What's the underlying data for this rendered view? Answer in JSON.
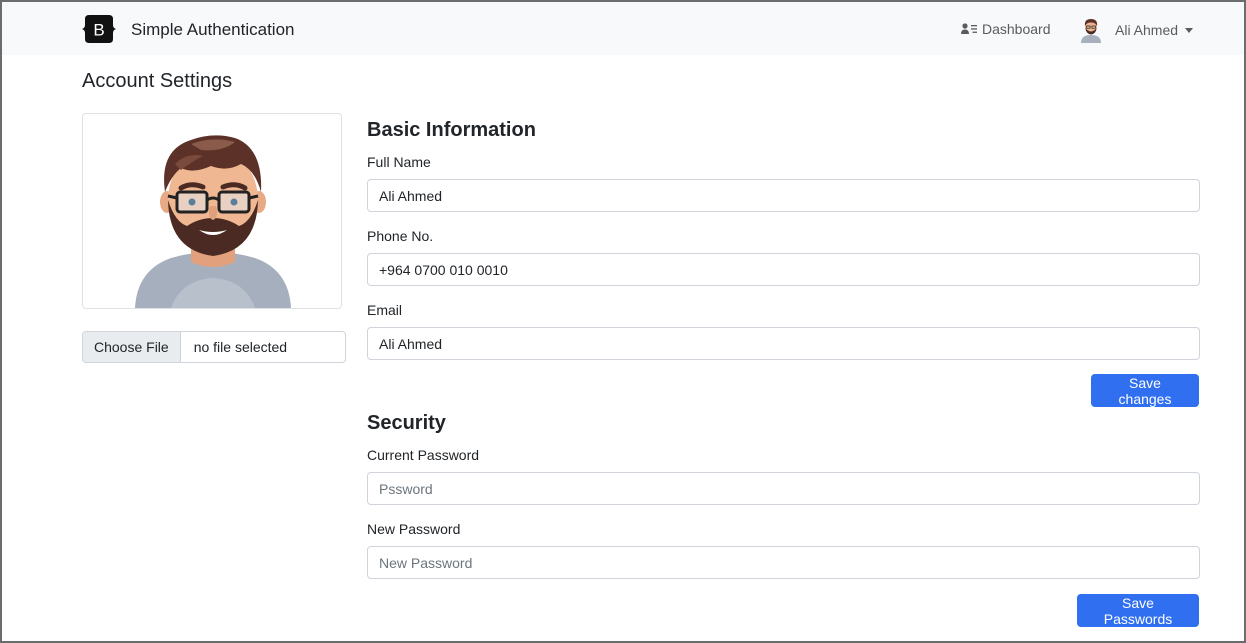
{
  "navbar": {
    "brand_letter": "B",
    "brand_name": "Simple Authentication",
    "dashboard_label": "Dashboard",
    "user_name": "Ali Ahmed"
  },
  "page": {
    "title": "Account Settings"
  },
  "avatar": {
    "file_button": "Choose File",
    "file_status": "no file selected"
  },
  "basic_info": {
    "title": "Basic Information",
    "full_name_label": "Full Name",
    "full_name_value": "Ali Ahmed",
    "phone_label": "Phone No.",
    "phone_value": "+964 0700 010 0010",
    "email_label": "Email",
    "email_value": "Ali Ahmed",
    "save_label": "Save changes"
  },
  "security": {
    "title": "Security",
    "current_label": "Current Password",
    "current_placeholder": "Pssword",
    "new_label": "New Password",
    "new_placeholder": "New Password",
    "save_label": "Save Passwords"
  },
  "colors": {
    "primary": "#2f6ff0",
    "navbar_bg": "#f8f9fa",
    "border": "#ced4da"
  }
}
